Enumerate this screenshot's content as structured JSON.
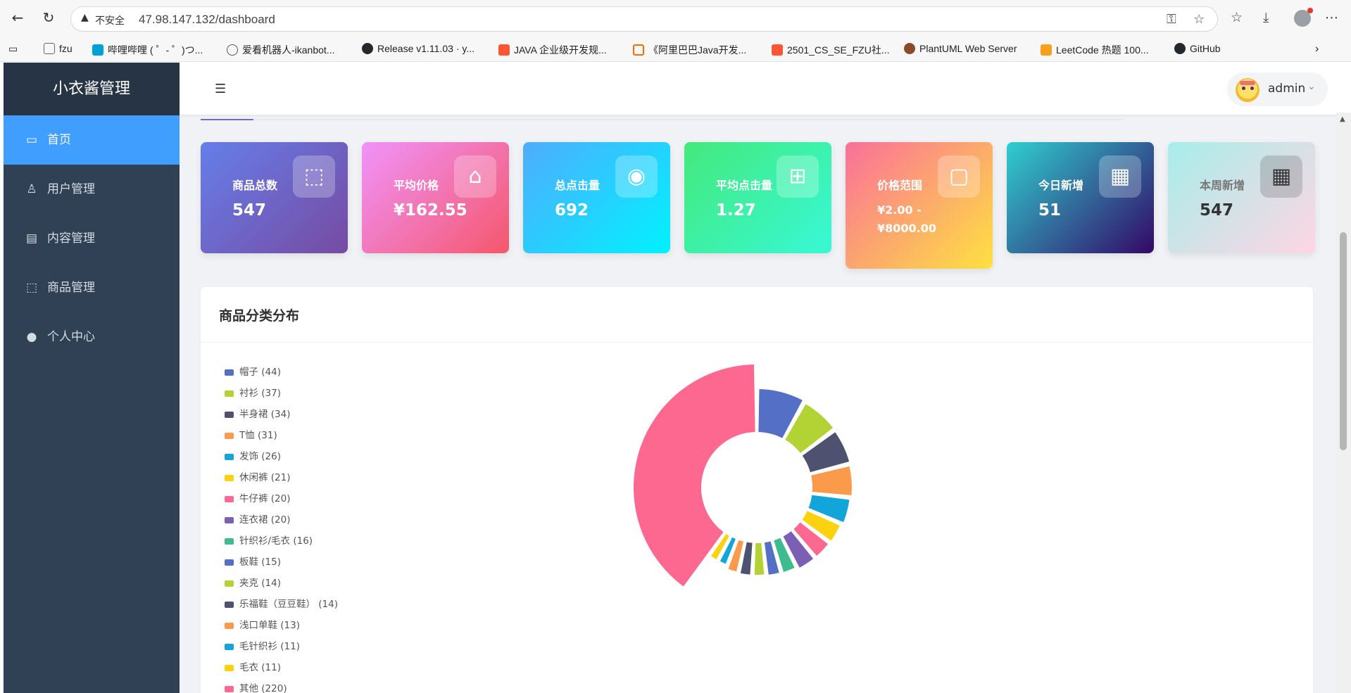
{
  "browser": {
    "insecure_label": "不安全",
    "url": "47.98.147.132/dashboard",
    "bookmarks": [
      {
        "label": "fzu",
        "color": "#666666"
      },
      {
        "label": "哔哩哔哩 ( ゜- ゜)つ...",
        "color": "#00a1d6"
      },
      {
        "label": "爱看机器人-ikanbot...",
        "color": "#555555"
      },
      {
        "label": "Release v1.11.03 · y...",
        "color": "#24292f"
      },
      {
        "label": "JAVA 企业级开发规...",
        "color": "#fc5531"
      },
      {
        "label": "《阿里巴巴Java开发...",
        "color": "#ff6a00"
      },
      {
        "label": "2501_CS_SE_FZU社...",
        "color": "#fc5531"
      },
      {
        "label": "PlantUML Web Server",
        "color": "#8a4b2a"
      },
      {
        "label": "LeetCode 热题 100...",
        "color": "#f89f1b"
      },
      {
        "label": "GitHub",
        "color": "#24292f"
      }
    ]
  },
  "sidebar": {
    "title": "小衣酱管理",
    "items": [
      {
        "label": "首页",
        "icon": "monitor-icon"
      },
      {
        "label": "用户管理",
        "icon": "user-icon"
      },
      {
        "label": "内容管理",
        "icon": "document-icon"
      },
      {
        "label": "商品管理",
        "icon": "box-icon"
      },
      {
        "label": "个人中心",
        "icon": "person-icon"
      }
    ]
  },
  "header": {
    "username": "admin"
  },
  "stats": [
    {
      "label": "商品总数",
      "value": "547",
      "icon": "box-icon",
      "gradient": [
        "#667eea",
        "#764ba2"
      ]
    },
    {
      "label": "平均价格",
      "value": "¥162.55",
      "icon": "price-tag-icon",
      "gradient": [
        "#f093fb",
        "#f5576c"
      ]
    },
    {
      "label": "总点击量",
      "value": "692",
      "icon": "eye-icon",
      "gradient": [
        "#4facfe",
        "#00f2fe"
      ]
    },
    {
      "label": "平均点击量",
      "value": "1.27",
      "icon": "presentation-icon",
      "gradient": [
        "#43e97b",
        "#38f9d7"
      ]
    },
    {
      "label": "价格范围",
      "value": "¥2.00 - ¥8000.00",
      "icon": "wallet-icon",
      "gradient": [
        "#fa709a",
        "#fee140"
      ]
    },
    {
      "label": "今日新增",
      "value": "51",
      "icon": "calendar-icon",
      "gradient": [
        "#30cfd0",
        "#330867"
      ]
    },
    {
      "label": "本周新增",
      "value": "547",
      "icon": "calendar-icon",
      "gradient": [
        "#a8edea",
        "#fed6e3"
      ]
    }
  ],
  "category_panel": {
    "title": "商品分类分布"
  },
  "chart_data": {
    "type": "pie",
    "variant": "rose-donut",
    "title": "商品分类分布",
    "legend_position": "left",
    "categories": [
      "帽子",
      "衬衫",
      "半身裙",
      "T恤",
      "发饰",
      "休闲裤",
      "牛仔裤",
      "连衣裙",
      "针织衫/毛衣",
      "板鞋",
      "夹克",
      "乐福鞋（豆豆鞋）",
      "浅口单鞋",
      "毛针织衫",
      "毛衣",
      "其他"
    ],
    "values": [
      44,
      37,
      34,
      31,
      26,
      21,
      20,
      20,
      16,
      15,
      14,
      14,
      13,
      11,
      11,
      220
    ],
    "legend_labels": [
      "帽子 (44)",
      "衬衫 (37)",
      "半身裙 (34)",
      "T恤 (31)",
      "发饰 (26)",
      "休闲裤 (21)",
      "牛仔裤 (20)",
      "连衣裙 (20)",
      "针织衫/毛衣 (16)",
      "板鞋 (15)",
      "夹克 (14)",
      "乐福鞋（豆豆鞋） (14)",
      "浅口单鞋 (13)",
      "毛针织衫 (11)",
      "毛衣 (11)",
      "其他 (220)"
    ],
    "colors": [
      "#5470c6",
      "#b3d334",
      "#4e5270",
      "#fc9a4b",
      "#12a5d9",
      "#fcd20e",
      "#fc6890",
      "#7b5fb4",
      "#3fbc8f",
      "#5470c6",
      "#b3d334",
      "#4e5270",
      "#fc9a4b",
      "#12a5d9",
      "#fcd20e",
      "#fc6890"
    ]
  }
}
